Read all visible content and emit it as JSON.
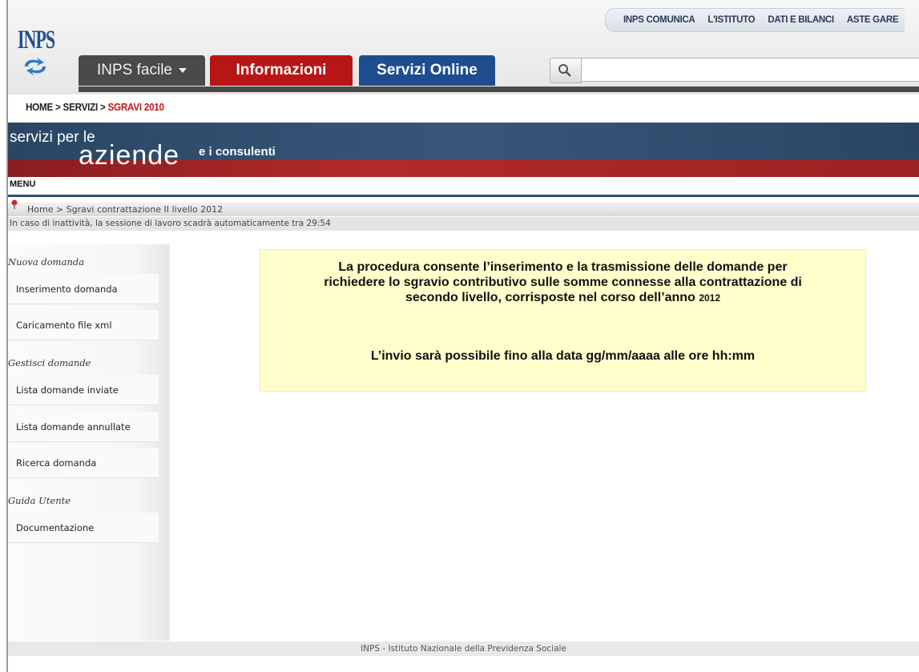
{
  "header": {
    "logo_text": "INPS",
    "top_links": [
      "INPS COMUNICA",
      "L'ISTITUTO",
      "DATI E BILANCI",
      "ASTE GARE"
    ],
    "tabs": {
      "facile": "INPS facile",
      "info": "Informazioni",
      "servizi": "Servizi Online"
    },
    "search_placeholder": ""
  },
  "breadcrumb": {
    "path": "HOME > SERVIZI > ",
    "current": "SGRAVI 2010"
  },
  "banner": {
    "line1": "servizi per le",
    "line2": "aziende",
    "line3": "e i consulenti",
    "menu_label": "MENU"
  },
  "subcrumb": "Home > Sgravi contrattazione II livello 2012",
  "session_text": "In caso di inattività, la sessione di lavoro scadrà automaticamente tra 29:54",
  "sidebar": {
    "sections": [
      {
        "title": "Nuova domanda",
        "items": [
          "Inserimento domanda",
          "Caricamento file xml"
        ]
      },
      {
        "title": "Gestisci domande",
        "items": [
          "Lista domande inviate",
          "Lista domande annullate",
          "Ricerca domanda"
        ]
      },
      {
        "title": "Guida Utente",
        "items": [
          "Documentazione"
        ]
      }
    ]
  },
  "notice": {
    "line1": "La procedura consente l’inserimento e la trasmissione delle domande per",
    "line2": "richiedere lo sgravio contributivo  sulle somme connesse alla contrattazione di",
    "line3": "secondo livello, corrisposte nel corso dell’anno",
    "year": "2012",
    "deadline": "L’invio sarà possibile fino alla data gg/mm/aaaa alle ore hh:mm"
  },
  "footer": "INPS - Istituto Nazionale della Previdenza Sociale",
  "colors": {
    "tab_red": "#b81616",
    "tab_blue": "#1f4c8f",
    "tab_gray": "#4a4a4a",
    "notice_bg": "#ffffcc"
  }
}
